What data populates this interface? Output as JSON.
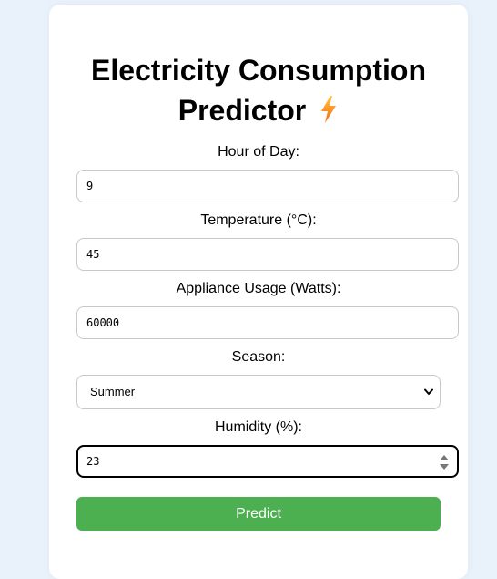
{
  "title": {
    "line1": "Electricity Consumption",
    "line2": "Predictor"
  },
  "icons": {
    "title_icon": "lightning-bolt-icon",
    "select_icon": "chevron-down-icon",
    "spinner_icon": "number-spinner-icon"
  },
  "form": {
    "hour": {
      "label": "Hour of Day:",
      "value": "9"
    },
    "temperature": {
      "label": "Temperature (°C):",
      "value": "45"
    },
    "appliance": {
      "label": "Appliance Usage (Watts):",
      "value": "60000"
    },
    "season": {
      "label": "Season:",
      "value": "Summer"
    },
    "humidity": {
      "label": "Humidity (%):",
      "value": "23"
    }
  },
  "predict_button": {
    "label": "Predict"
  },
  "colors": {
    "background": "#e9f1fb",
    "card": "#ffffff",
    "button": "#4caf50",
    "button_text": "#ffffff",
    "bolt_top": "#ffc83d",
    "bolt_bottom": "#f7630c"
  }
}
